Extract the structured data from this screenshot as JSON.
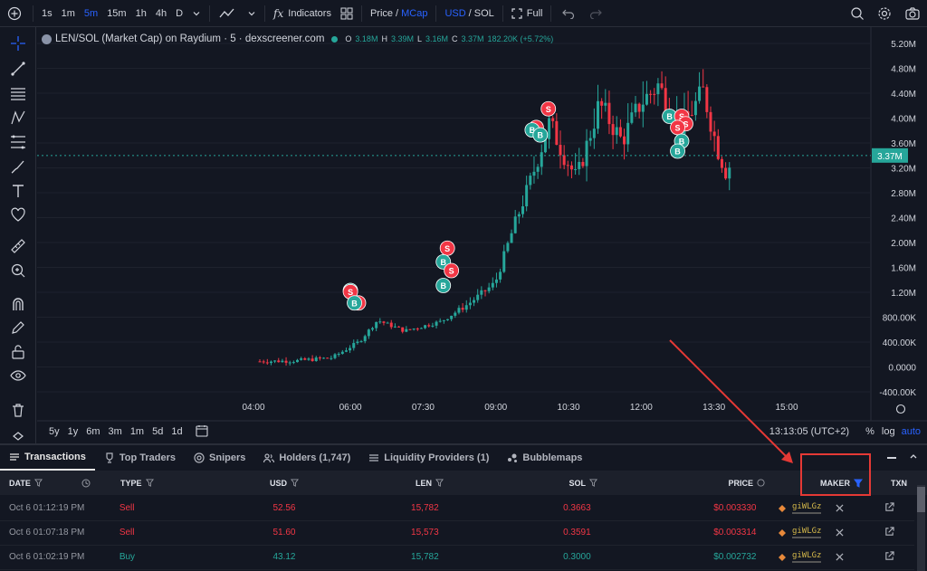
{
  "toolbar": {
    "timeframes": [
      "1s",
      "1m",
      "5m",
      "15m",
      "1h",
      "4h",
      "D"
    ],
    "active_timeframe": "5m",
    "indicators_label": "Indicators",
    "price_label": "Price",
    "separator": "/",
    "mcap_label": "MCap",
    "usd_label": "USD",
    "sol_label": "SOL",
    "full_label": "Full"
  },
  "legend": {
    "title": "LEN/SOL (Market Cap) on Raydium · 5 · dexscreener.com",
    "o_label": "O",
    "o_value": "3.18M",
    "h_label": "H",
    "h_value": "3.39M",
    "l_label": "L",
    "l_value": "3.16M",
    "c_label": "C",
    "c_value": "3.37M",
    "change": "182.20K (+5.72%)"
  },
  "chart_data": {
    "type": "candlestick",
    "y_ticks": [
      "5.20M",
      "4.80M",
      "4.40M",
      "4.00M",
      "3.60M",
      "3.20M",
      "2.80M",
      "2.40M",
      "2.00M",
      "1.60M",
      "1.20M",
      "800.00K",
      "400.00K",
      "0.0000",
      "-400.00K"
    ],
    "x_ticks": [
      "04:00",
      "06:00",
      "07:30",
      "09:00",
      "10:30",
      "12:00",
      "13:30",
      "15:00"
    ],
    "last_price_label": "3.37M",
    "ylim": [
      -400000,
      5200000
    ],
    "trades": [
      {
        "label": "B",
        "x": "06:00",
        "y": 1200000,
        "color": "#26a69a"
      },
      {
        "label": "S",
        "x": "06:00",
        "y": 1180000,
        "color": "#f23645"
      },
      {
        "label": "S",
        "x": "06:10",
        "y": 1000000,
        "color": "#f23645"
      },
      {
        "label": "B",
        "x": "06:05",
        "y": 1000000,
        "color": "#26a69a"
      },
      {
        "label": "S",
        "x": "08:00",
        "y": 1880000,
        "color": "#f23645"
      },
      {
        "label": "B",
        "x": "07:55",
        "y": 1660000,
        "color": "#26a69a"
      },
      {
        "label": "S",
        "x": "08:05",
        "y": 1520000,
        "color": "#f23645"
      },
      {
        "label": "B",
        "x": "07:55",
        "y": 1280000,
        "color": "#26a69a"
      },
      {
        "label": "S",
        "x": "10:05",
        "y": 4120000,
        "color": "#f23645"
      },
      {
        "label": "S",
        "x": "09:50",
        "y": 3820000,
        "color": "#f23645"
      },
      {
        "label": "B",
        "x": "09:45",
        "y": 3780000,
        "color": "#26a69a"
      },
      {
        "label": "B",
        "x": "09:55",
        "y": 3700000,
        "color": "#26a69a"
      },
      {
        "label": "B",
        "x": "12:35",
        "y": 4000000,
        "color": "#26a69a"
      },
      {
        "label": "S",
        "x": "12:50",
        "y": 4000000,
        "color": "#f23645"
      },
      {
        "label": "S",
        "x": "12:55",
        "y": 3880000,
        "color": "#f23645"
      },
      {
        "label": "S",
        "x": "12:45",
        "y": 3820000,
        "color": "#f23645"
      },
      {
        "label": "B",
        "x": "12:50",
        "y": 3600000,
        "color": "#26a69a"
      },
      {
        "label": "B",
        "x": "12:45",
        "y": 3440000,
        "color": "#26a69a"
      }
    ]
  },
  "bottom_bar": {
    "ranges": [
      "5y",
      "1y",
      "6m",
      "3m",
      "1m",
      "5d",
      "1d"
    ],
    "time": "13:13:05 (UTC+2)",
    "percent": "%",
    "log": "log",
    "auto": "auto"
  },
  "panel": {
    "tabs": [
      "Transactions",
      "Top Traders",
      "Snipers",
      "Holders (1,747)",
      "Liquidity Providers (1)",
      "Bubblemaps"
    ],
    "columns": [
      "DATE",
      "TYPE",
      "USD",
      "LEN",
      "SOL",
      "PRICE",
      "MAKER",
      "TXN"
    ],
    "rows": [
      {
        "date": "Oct 6 01:12:19 PM",
        "type": "Sell",
        "usd": "52.56",
        "len": "15,782",
        "sol": "0.3663",
        "price": "$0.003330",
        "maker": "giWLGz"
      },
      {
        "date": "Oct 6 01:07:18 PM",
        "type": "Sell",
        "usd": "51.60",
        "len": "15,573",
        "sol": "0.3591",
        "price": "$0.003314",
        "maker": "giWLGz"
      },
      {
        "date": "Oct 6 01:02:19 PM",
        "type": "Buy",
        "usd": "43.12",
        "len": "15,782",
        "sol": "0.3000",
        "price": "$0.002732",
        "maker": "giWLGz"
      }
    ]
  },
  "colors": {
    "up": "#26a69a",
    "down": "#f23645",
    "accent": "#2962ff",
    "annotation": "#e53935"
  }
}
